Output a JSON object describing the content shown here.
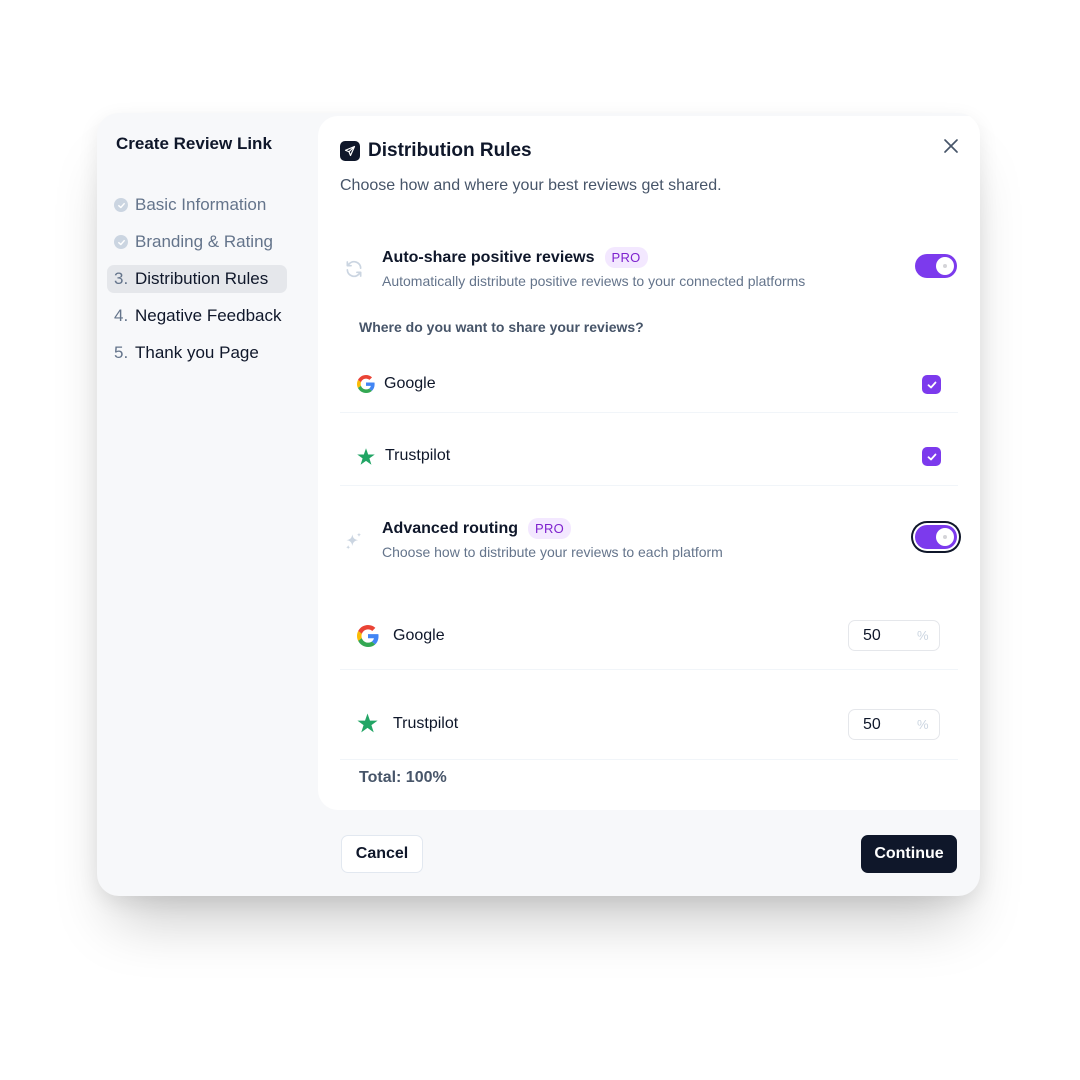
{
  "sidebar": {
    "title": "Create Review Link",
    "steps": [
      {
        "number": "",
        "label": "Basic Information",
        "state": "done"
      },
      {
        "number": "",
        "label": "Branding & Rating",
        "state": "done"
      },
      {
        "number": "3.",
        "label": "Distribution Rules",
        "state": "active"
      },
      {
        "number": "4.",
        "label": "Negative Feedback",
        "state": "todo"
      },
      {
        "number": "5.",
        "label": "Thank you Page",
        "state": "todo"
      }
    ]
  },
  "header": {
    "icon": "send-icon",
    "title": "Distribution Rules",
    "subtitle": "Choose how and where your best reviews get shared."
  },
  "auto_share": {
    "icon": "refresh-icon",
    "title": "Auto-share positive reviews",
    "badge": "PRO",
    "description": "Automatically distribute positive reviews to your connected platforms",
    "enabled": true
  },
  "platforms": {
    "question": "Where do you want to share your reviews?",
    "items": [
      {
        "name": "Google",
        "icon": "google-icon",
        "checked": true
      },
      {
        "name": "Trustpilot",
        "icon": "star-icon",
        "checked": true
      }
    ]
  },
  "routing": {
    "icon": "sparkles-icon",
    "title": "Advanced routing",
    "badge": "PRO",
    "description": "Choose how to distribute your reviews to each platform",
    "enabled": true,
    "items": [
      {
        "name": "Google",
        "icon": "google-icon",
        "value": "50",
        "unit": "%"
      },
      {
        "name": "Trustpilot",
        "icon": "star-icon",
        "value": "50",
        "unit": "%"
      }
    ],
    "total": "Total: 100%"
  },
  "footer": {
    "cancel_label": "Cancel",
    "continue_label": "Continue"
  },
  "colors": {
    "accent": "#7c3aed",
    "primary": "#0f172a",
    "pro_badge_bg": "#f3e8ff",
    "pro_badge_text": "#7e22ce",
    "trustpilot_green": "#22a565"
  }
}
